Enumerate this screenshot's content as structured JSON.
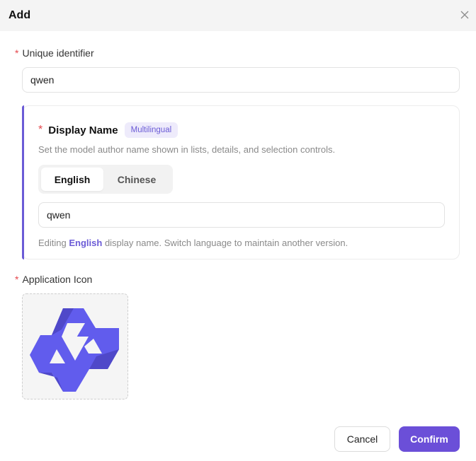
{
  "dialog": {
    "title": "Add",
    "close_icon": "close-icon"
  },
  "unique_identifier": {
    "label": "Unique identifier",
    "required_mark": "*",
    "value": "qwen"
  },
  "display_name": {
    "required_mark": "*",
    "label": "Display Name",
    "badge": "Multilingual",
    "helper": "Set the model author name shown in lists, details, and selection controls.",
    "tabs": [
      {
        "label": "English",
        "active": true
      },
      {
        "label": "Chinese",
        "active": false
      }
    ],
    "value": "qwen",
    "footnote_prefix": "Editing ",
    "footnote_language": "English",
    "footnote_suffix": " display name. Switch language to maintain another version."
  },
  "application_icon": {
    "required_mark": "*",
    "label": "Application Icon",
    "icon": "qwen-logo-icon",
    "icon_color": "#615ced"
  },
  "footer": {
    "cancel_label": "Cancel",
    "confirm_label": "Confirm"
  },
  "colors": {
    "accent": "#6b4fd8",
    "required": "#e5484d",
    "header_bg": "#f4f4f4"
  }
}
